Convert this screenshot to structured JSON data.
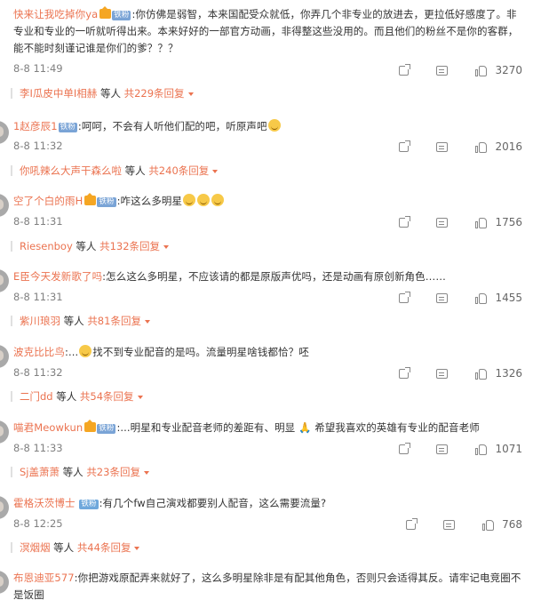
{
  "comments": [
    {
      "user": "快来让我吃掉你ya",
      "crown": true,
      "badge": "铁粉",
      "text": ":你仿佛是弱智，本来国配受众就低，你弄几个非专业的放进去，更拉低好感度了。非专业和专业的一听就听得出来。本来好好的一部官方动画，非得整这些没用的。而且他们的粉丝不是你的客群，能不能时刻谨记谁是你们的爹？？？",
      "time": "8-8 11:49",
      "likes": "3270",
      "reply_user": "李I瓜皮中单I相赫",
      "reply_mid": " 等人 ",
      "reply_count": "共229条回复"
    },
    {
      "user": "1赵彦辰1",
      "badge": "铁粉",
      "text": ":呵呵，不会有人听他们配的吧，听原声吧",
      "time": "8-8 11:32",
      "likes": "2016",
      "reply_user": "你吼辣么大声干森么啦",
      "reply_mid": " 等人 ",
      "reply_count": "共240条回复"
    },
    {
      "user": "空了个白的雨H",
      "crown": true,
      "badge": "铁粉",
      "text": ":咋这么多明星",
      "time": "8-8 11:31",
      "likes": "1756",
      "reply_user": "Riesenboy",
      "reply_mid": " 等人 ",
      "reply_count": "共132条回复"
    },
    {
      "user": "E臣今天发新歌了吗",
      "text": ":怎么这么多明星，不应该请的都是原版声优吗，还是动画有原创新角色……",
      "time": "8-8 11:31",
      "likes": "1455",
      "reply_user": "紫川琅羽",
      "reply_mid": " 等人 ",
      "reply_count": "共81条回复"
    },
    {
      "user": "波克比比鸟",
      "text_pre": ":...",
      "text": "找不到专业配音的是吗。流量明星啥钱都恰？呸",
      "time": "8-8 11:32",
      "likes": "1326",
      "reply_user": "二门dd",
      "reply_mid": " 等人 ",
      "reply_count": "共54条回复"
    },
    {
      "user": "喵君Meowkun",
      "crown": true,
      "badge": "铁粉",
      "text": ":...明星和专业配音老师的差距有、明显 🙏 希望我喜欢的英雄有专业的配音老师",
      "time": "8-8 11:33",
      "likes": "1071",
      "reply_user": "Sj盖萧萧",
      "reply_mid": " 等人 ",
      "reply_count": "共23条回复"
    },
    {
      "user": "霍格沃茨博士",
      "badge": "铁粉",
      "text": ":有几个fw自己演戏都要别人配音，这么需要流量?",
      "time": "8-8 12:25",
      "likes": "768",
      "reply_user": "溟烟烟",
      "reply_mid": " 等人 ",
      "reply_count": "共44条回复"
    },
    {
      "user": "布恩迪亚577",
      "text": ":你把游戏原配弄来就好了，这么多明星除非是有配其他角色，否则只会适得其反。请牢记电竞圈不是饭圈"
    }
  ]
}
